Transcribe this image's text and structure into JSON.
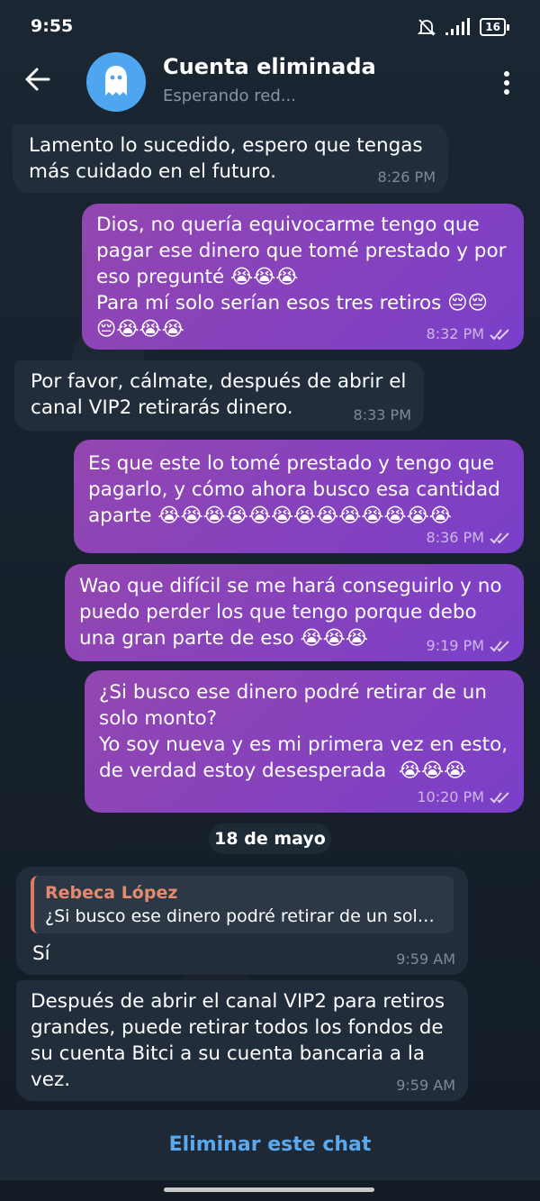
{
  "status_bar": {
    "time": "9:55",
    "battery": "16"
  },
  "header": {
    "title": "Cuenta eliminada",
    "subtitle": "Esperando red..."
  },
  "messages": [
    {
      "direction": "in",
      "text": "Lamento lo sucedido, espero que tengas\nmás cuidado en el futuro.",
      "time": "8:26 PM"
    },
    {
      "direction": "out",
      "text": "Dios, no quería equivocarme tengo que\npagar ese dinero que tomé prestado y por\neso pregunté 😭😭😭\nPara mí solo serían esos tres retiros 😔😔\n😔😭😭😭",
      "time": "8:32 PM"
    },
    {
      "direction": "in",
      "text": "Por favor, cálmate, después de abrir el\ncanal VIP2 retirarás dinero.",
      "time": "8:33 PM"
    },
    {
      "direction": "out",
      "text": "Es que este lo tomé prestado y tengo que\npagarlo, y cómo ahora busco esa cantidad\naparte 😭😭😭😭😭😭😭😭😭😭😭😭😭",
      "time": "8:36 PM"
    },
    {
      "direction": "out",
      "text": "Wao que difícil se me hará conseguirlo y no\npuedo perder los que tengo porque debo\nuna gran parte de eso 😭😭😭",
      "time": "9:19 PM"
    },
    {
      "direction": "out",
      "text": "¿Si busco ese dinero podré retirar de un\nsolo monto?\nYo soy nueva y es mi primera vez en esto,\nde verdad estoy desesperada  😭😭😭",
      "time": "10:20 PM"
    },
    {
      "direction": "in",
      "reply_name": "Rebeca López",
      "reply_text": "¿Si busco ese dinero podré retirar de un solo…",
      "text": "Sí",
      "time": "9:59 AM"
    },
    {
      "direction": "in",
      "text": "Después de abrir el canal VIP2 para retiros\ngrandes, puede retirar todos los fondos de\nsu cuenta Bitci a su cuenta bancaria a la\nvez.",
      "time": "9:59 AM"
    }
  ],
  "date_separator": "18 de mayo",
  "bottom_action": "Eliminar este chat",
  "colors": {
    "accent": "#58a9ef",
    "outgoing": "#8a43be",
    "incoming": "#212d3b",
    "reply_name": "#e58a6f"
  },
  "icons": {
    "back": "arrow-left-icon",
    "avatar": "ghost-icon",
    "menu": "more-vertical-icon",
    "read": "double-check-icon"
  }
}
